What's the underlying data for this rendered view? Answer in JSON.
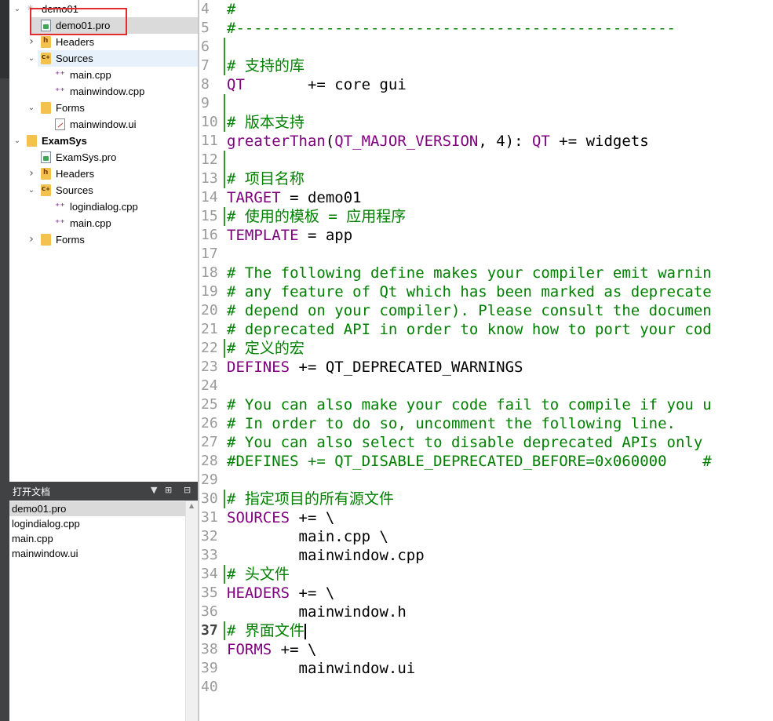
{
  "project_tree": {
    "items": [
      {
        "label": "demo01",
        "depth": 0,
        "arrow": "down",
        "icon": "spinner-icon",
        "state": ""
      },
      {
        "label": "demo01.pro",
        "depth": 1,
        "arrow": "",
        "icon": "pro-file-icon",
        "state": "selected"
      },
      {
        "label": "Headers",
        "depth": 1,
        "arrow": "right",
        "icon": "header-folder-icon",
        "state": ""
      },
      {
        "label": "Sources",
        "depth": 1,
        "arrow": "down",
        "icon": "source-folder-icon",
        "state": "hover"
      },
      {
        "label": "main.cpp",
        "depth": 2,
        "arrow": "",
        "icon": "cpp-file-icon",
        "state": ""
      },
      {
        "label": "mainwindow.cpp",
        "depth": 2,
        "arrow": "",
        "icon": "cpp-file-icon",
        "state": ""
      },
      {
        "label": "Forms",
        "depth": 1,
        "arrow": "down",
        "icon": "forms-folder-icon",
        "state": ""
      },
      {
        "label": "mainwindow.ui",
        "depth": 2,
        "arrow": "",
        "icon": "ui-file-icon",
        "state": ""
      },
      {
        "label": "ExamSys",
        "depth": 0,
        "arrow": "down",
        "icon": "project-icon",
        "state": "",
        "bold": true
      },
      {
        "label": "ExamSys.pro",
        "depth": 1,
        "arrow": "",
        "icon": "pro-file-icon",
        "state": ""
      },
      {
        "label": "Headers",
        "depth": 1,
        "arrow": "right",
        "icon": "header-folder-icon",
        "state": ""
      },
      {
        "label": "Sources",
        "depth": 1,
        "arrow": "down",
        "icon": "source-folder-icon",
        "state": ""
      },
      {
        "label": "logindialog.cpp",
        "depth": 2,
        "arrow": "",
        "icon": "cpp-file-icon",
        "state": ""
      },
      {
        "label": "main.cpp",
        "depth": 2,
        "arrow": "",
        "icon": "cpp-file-icon",
        "state": ""
      },
      {
        "label": "Forms",
        "depth": 1,
        "arrow": "right",
        "icon": "forms-folder-icon",
        "state": ""
      }
    ]
  },
  "open_documents": {
    "title": "打开文档",
    "items": [
      "demo01.pro",
      "logindialog.cpp",
      "main.cpp",
      "mainwindow.ui"
    ],
    "active_index": 0
  },
  "editor": {
    "current_line": 37,
    "lines": [
      {
        "n": "4",
        "mark": false,
        "tokens": [
          {
            "t": "#",
            "c": "comment"
          }
        ]
      },
      {
        "n": "5",
        "mark": false,
        "tokens": [
          {
            "t": "#-------------------------------------------------",
            "c": "comment"
          }
        ]
      },
      {
        "n": "6",
        "mark": true,
        "tokens": []
      },
      {
        "n": "7",
        "mark": true,
        "tokens": [
          {
            "t": "# 支持的库",
            "c": "comment"
          }
        ]
      },
      {
        "n": "8",
        "mark": false,
        "tokens": [
          {
            "t": "QT",
            "c": "kw"
          },
          {
            "t": "       += core gui",
            "c": "plain"
          }
        ]
      },
      {
        "n": "9",
        "mark": true,
        "tokens": []
      },
      {
        "n": "10",
        "mark": true,
        "tokens": [
          {
            "t": "# 版本支持",
            "c": "comment"
          }
        ]
      },
      {
        "n": "11",
        "mark": false,
        "tokens": [
          {
            "t": "greaterThan",
            "c": "kw"
          },
          {
            "t": "(",
            "c": "plain"
          },
          {
            "t": "QT_MAJOR_VERSION",
            "c": "kw"
          },
          {
            "t": ", 4): ",
            "c": "plain"
          },
          {
            "t": "QT",
            "c": "kw"
          },
          {
            "t": " += widgets",
            "c": "plain"
          }
        ]
      },
      {
        "n": "12",
        "mark": true,
        "tokens": []
      },
      {
        "n": "13",
        "mark": true,
        "tokens": [
          {
            "t": "# 项目名称",
            "c": "comment"
          }
        ]
      },
      {
        "n": "14",
        "mark": false,
        "tokens": [
          {
            "t": "TARGET",
            "c": "kw"
          },
          {
            "t": " = demo01",
            "c": "plain"
          }
        ]
      },
      {
        "n": "15",
        "mark": true,
        "tokens": [
          {
            "t": "# 使用的模板 = 应用程序",
            "c": "comment"
          }
        ]
      },
      {
        "n": "16",
        "mark": false,
        "tokens": [
          {
            "t": "TEMPLATE",
            "c": "kw"
          },
          {
            "t": " = app",
            "c": "plain"
          }
        ]
      },
      {
        "n": "17",
        "mark": false,
        "tokens": []
      },
      {
        "n": "18",
        "mark": false,
        "tokens": [
          {
            "t": "# The following define makes your compiler emit warnin",
            "c": "comment"
          }
        ]
      },
      {
        "n": "19",
        "mark": false,
        "tokens": [
          {
            "t": "# any feature of Qt which has been marked as deprecate",
            "c": "comment"
          }
        ]
      },
      {
        "n": "20",
        "mark": false,
        "tokens": [
          {
            "t": "# depend on your compiler). Please consult the documen",
            "c": "comment"
          }
        ]
      },
      {
        "n": "21",
        "mark": false,
        "tokens": [
          {
            "t": "# deprecated API in order to know how to port your cod",
            "c": "comment"
          }
        ]
      },
      {
        "n": "22",
        "mark": true,
        "tokens": [
          {
            "t": "# 定义的宏",
            "c": "comment"
          }
        ]
      },
      {
        "n": "23",
        "mark": false,
        "tokens": [
          {
            "t": "DEFINES",
            "c": "kw"
          },
          {
            "t": " += QT_DEPRECATED_WARNINGS",
            "c": "plain"
          }
        ]
      },
      {
        "n": "24",
        "mark": false,
        "tokens": []
      },
      {
        "n": "25",
        "mark": false,
        "tokens": [
          {
            "t": "# You can also make your code fail to compile if you u",
            "c": "comment"
          }
        ]
      },
      {
        "n": "26",
        "mark": false,
        "tokens": [
          {
            "t": "# In order to do so, uncomment the following line.",
            "c": "comment"
          }
        ]
      },
      {
        "n": "27",
        "mark": false,
        "tokens": [
          {
            "t": "# You can also select to disable deprecated APIs only ",
            "c": "comment"
          }
        ]
      },
      {
        "n": "28",
        "mark": false,
        "tokens": [
          {
            "t": "#DEFINES += QT_DISABLE_DEPRECATED_BEFORE=0x060000    #",
            "c": "comment"
          }
        ]
      },
      {
        "n": "29",
        "mark": false,
        "tokens": []
      },
      {
        "n": "30",
        "mark": true,
        "tokens": [
          {
            "t": "# 指定项目的所有源文件",
            "c": "comment"
          }
        ]
      },
      {
        "n": "31",
        "mark": false,
        "tokens": [
          {
            "t": "SOURCES",
            "c": "kw"
          },
          {
            "t": " += \\",
            "c": "plain"
          }
        ]
      },
      {
        "n": "32",
        "mark": false,
        "tokens": [
          {
            "t": "        main.cpp \\",
            "c": "plain"
          }
        ]
      },
      {
        "n": "33",
        "mark": false,
        "tokens": [
          {
            "t": "        mainwindow.cpp",
            "c": "plain"
          }
        ]
      },
      {
        "n": "34",
        "mark": true,
        "tokens": [
          {
            "t": "# 头文件",
            "c": "comment"
          }
        ]
      },
      {
        "n": "35",
        "mark": false,
        "tokens": [
          {
            "t": "HEADERS",
            "c": "kw"
          },
          {
            "t": " += \\",
            "c": "plain"
          }
        ]
      },
      {
        "n": "36",
        "mark": false,
        "tokens": [
          {
            "t": "        mainwindow.h",
            "c": "plain"
          }
        ]
      },
      {
        "n": "37",
        "mark": true,
        "tokens": [
          {
            "t": "# 界面文件",
            "c": "comment"
          }
        ],
        "cursor": true
      },
      {
        "n": "38",
        "mark": false,
        "tokens": [
          {
            "t": "FORMS",
            "c": "kw"
          },
          {
            "t": " += \\",
            "c": "plain"
          }
        ]
      },
      {
        "n": "39",
        "mark": false,
        "tokens": [
          {
            "t": "        mainwindow.ui",
            "c": "plain"
          }
        ]
      },
      {
        "n": "40",
        "mark": false,
        "tokens": []
      }
    ]
  },
  "colors": {
    "comment": "#008000",
    "keyword": "#800080",
    "text": "#000000",
    "selection_outline": "#e32b2b",
    "panel_dark": "#404244"
  }
}
